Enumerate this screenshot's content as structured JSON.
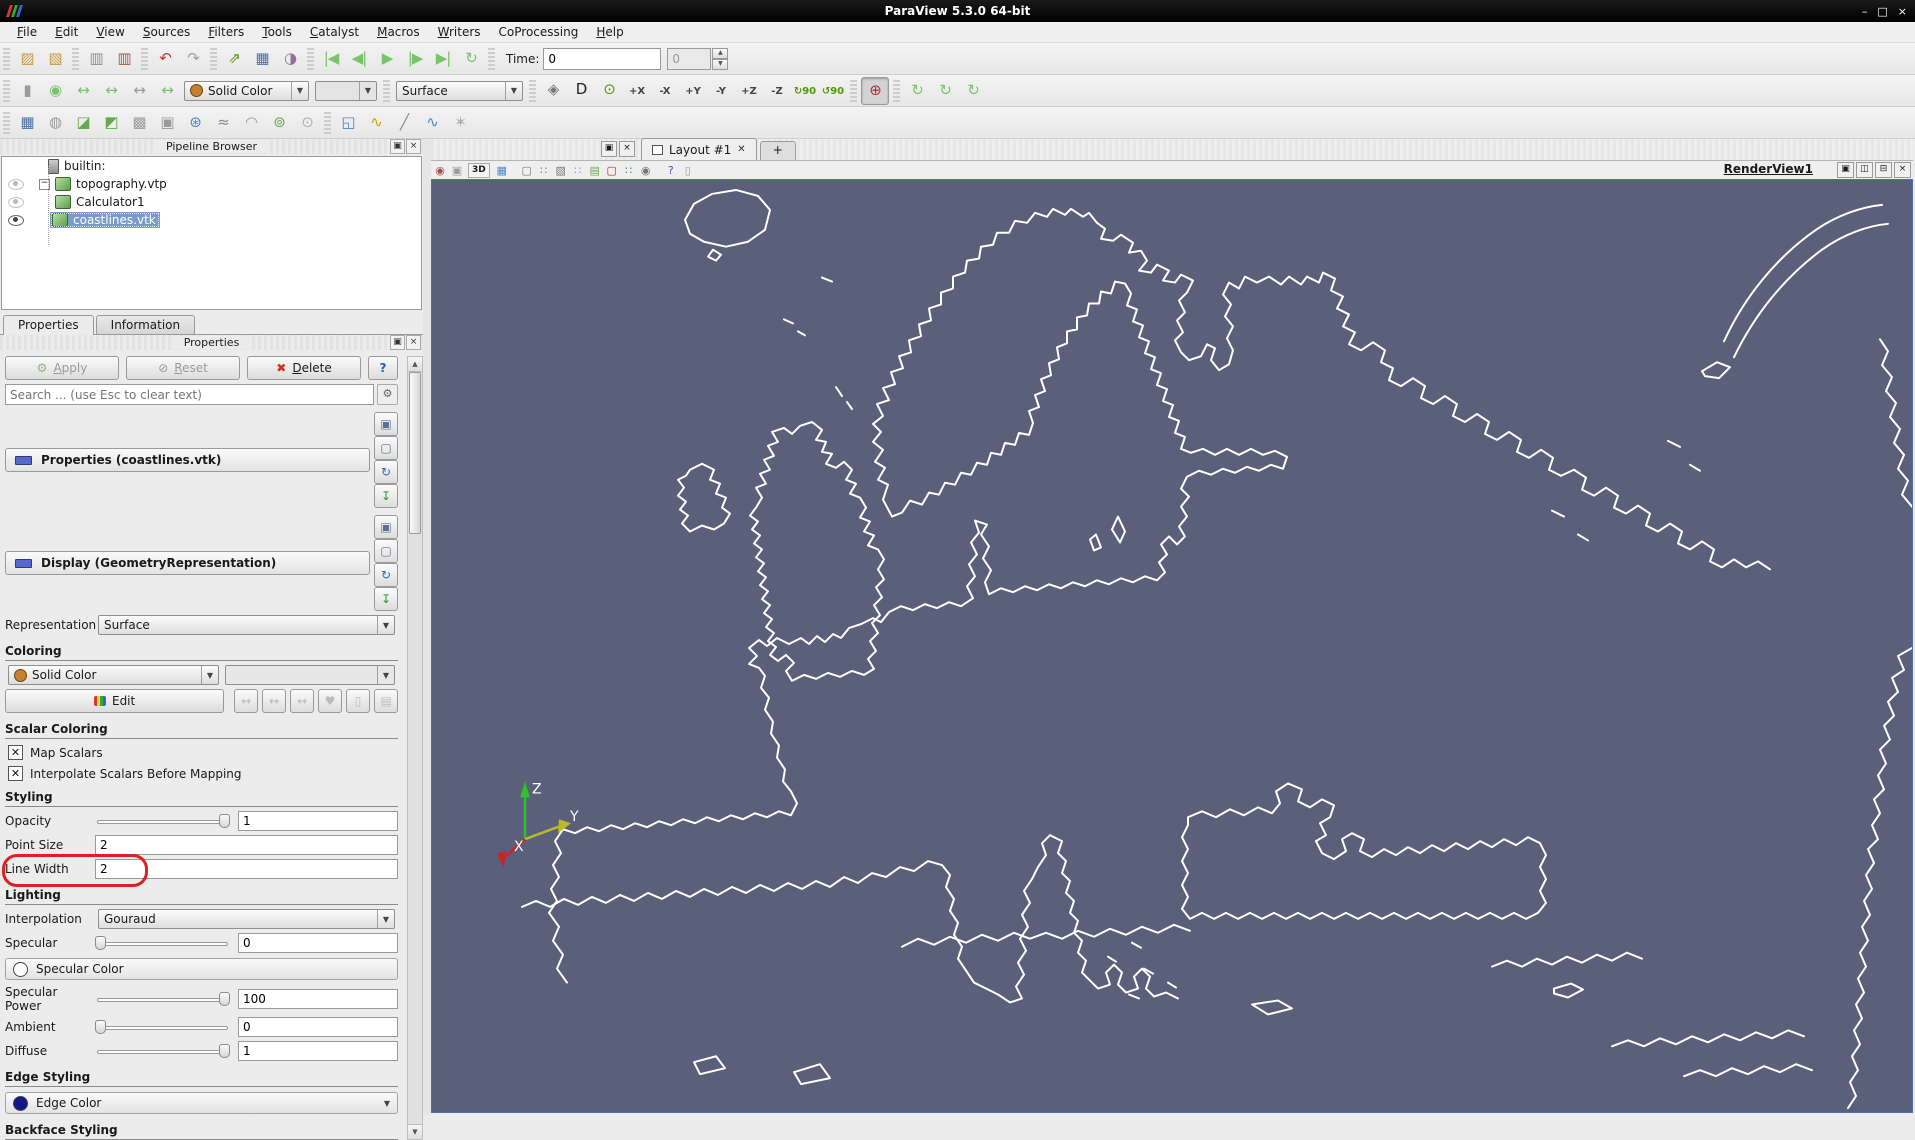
{
  "window": {
    "title": "ParaView 5.3.0 64-bit",
    "minimize": "–",
    "maximize": "□",
    "close": "×"
  },
  "menu": {
    "items": [
      {
        "label": "File",
        "u": 0
      },
      {
        "label": "Edit",
        "u": 0
      },
      {
        "label": "View",
        "u": 0
      },
      {
        "label": "Sources",
        "u": 0
      },
      {
        "label": "Filters",
        "u": 0
      },
      {
        "label": "Tools",
        "u": 0
      },
      {
        "label": "Catalyst",
        "u": 0
      },
      {
        "label": "Macros",
        "u": 0
      },
      {
        "label": "Writers",
        "u": 0
      },
      {
        "label": "CoProcessing",
        "u": -1
      },
      {
        "label": "Help",
        "u": 0
      }
    ]
  },
  "toolbar1": {
    "file_group": [
      {
        "name": "open-icon",
        "glyph": "▨",
        "color": "#c59a3f"
      },
      {
        "name": "save-data-icon",
        "glyph": "▧",
        "color": "#c59a3f"
      }
    ],
    "server_group": [
      {
        "name": "connect-icon",
        "glyph": "▥",
        "color": "#8f8f8f"
      },
      {
        "name": "disconnect-icon",
        "glyph": "▥",
        "color": "#a2564a"
      }
    ],
    "undo_group": [
      {
        "name": "undo-icon",
        "glyph": "↶",
        "color": "#c0392b"
      },
      {
        "name": "redo-icon",
        "glyph": "↷",
        "color": "#a0a0a0"
      }
    ],
    "state_group": [
      {
        "name": "load-state-icon",
        "glyph": "⇗",
        "color": "#4e9a06"
      },
      {
        "name": "save-animation-icon",
        "glyph": "▦",
        "color": "#4a6fa5"
      },
      {
        "name": "color-palette-icon",
        "glyph": "◑",
        "color": "#8f6f9f"
      }
    ],
    "vcr_group": [
      {
        "name": "first-frame-icon",
        "glyph": "|◀",
        "color": "#79c36a"
      },
      {
        "name": "previous-frame-icon",
        "glyph": "◀|",
        "color": "#79c36a"
      },
      {
        "name": "play-icon",
        "glyph": "▶",
        "color": "#79c36a"
      },
      {
        "name": "next-frame-icon",
        "glyph": "|▶",
        "color": "#79c36a"
      },
      {
        "name": "last-frame-icon",
        "glyph": "▶|",
        "color": "#79c36a"
      },
      {
        "name": "loop-icon",
        "glyph": "↻",
        "color": "#79c36a"
      }
    ],
    "time_label": "Time:",
    "time_value": "0",
    "frame_value": "0"
  },
  "toolbar2": {
    "color_group": [
      {
        "name": "toggle-color-legend-icon",
        "glyph": "▮",
        "color": "#9a9a9a"
      },
      {
        "name": "edit-color-map-icon",
        "glyph": "◉",
        "color": "#79c36a"
      },
      {
        "name": "rescale-data-range-icon",
        "glyph": "↔",
        "color": "#79c36a"
      },
      {
        "name": "rescale-custom-range-icon",
        "glyph": "↔",
        "color": "#79c36a"
      },
      {
        "name": "rescale-temporal-range-icon",
        "glyph": "↔",
        "color": "#9a9a9a"
      },
      {
        "name": "rescale-visible-range-icon",
        "glyph": "↔",
        "color": "#79c36a"
      }
    ],
    "color_by_value": "Solid Color",
    "color_by_dot": "#c87f2f",
    "array_value": "",
    "representation_value": "Surface",
    "combo_arrow": "▼",
    "camera_group": [
      {
        "name": "reset-camera-icon",
        "glyph": "◈",
        "color": "#777777"
      },
      {
        "name": "zoom-to-data-icon",
        "glyph": "D",
        "color": "#222222"
      },
      {
        "name": "zoom-to-selection-icon",
        "glyph": "⊙",
        "color": "#4e9a06"
      },
      {
        "name": "view-plus-x-icon",
        "glyph": "+X",
        "color": "#444444",
        "ax": true
      },
      {
        "name": "view-minus-x-icon",
        "glyph": "-X",
        "color": "#444444",
        "ax": true
      },
      {
        "name": "view-plus-y-icon",
        "glyph": "+Y",
        "color": "#444444",
        "ax": true
      },
      {
        "name": "view-minus-y-icon",
        "glyph": "-Y",
        "color": "#444444",
        "ax": true
      },
      {
        "name": "view-plus-z-icon",
        "glyph": "+Z",
        "color": "#444444",
        "ax": true
      },
      {
        "name": "view-minus-z-icon",
        "glyph": "-Z",
        "color": "#444444",
        "ax": true
      },
      {
        "name": "rotate-plus-90-icon",
        "glyph": "↻90",
        "color": "#4e9a06",
        "ax": true
      },
      {
        "name": "rotate-minus-90-icon",
        "glyph": "↺90",
        "color": "#4e9a06",
        "ax": true
      }
    ],
    "axes_toggle": [
      {
        "name": "show-orientation-axes-icon",
        "glyph": "⊕",
        "color": "#b03030",
        "pressed": true
      }
    ],
    "center_group": [
      {
        "name": "show-center-rotation-icon",
        "glyph": "↻",
        "color": "#79c36a"
      },
      {
        "name": "pick-center-icon",
        "glyph": "↻",
        "color": "#79c36a"
      },
      {
        "name": "reset-center-icon",
        "glyph": "↻",
        "color": "#79c36a"
      }
    ]
  },
  "toolbar3": {
    "filters_group": [
      {
        "name": "calculator-icon",
        "glyph": "▦",
        "color": "#4a6fa5"
      },
      {
        "name": "contour-icon",
        "glyph": "◍",
        "color": "#9a9a9a"
      },
      {
        "name": "clip-icon",
        "glyph": "◪",
        "color": "#6aa84f"
      },
      {
        "name": "slice-icon",
        "glyph": "◩",
        "color": "#6aa84f"
      },
      {
        "name": "threshold-icon",
        "glyph": "▩",
        "color": "#9a9a9a"
      },
      {
        "name": "extract-subset-icon",
        "glyph": "▣",
        "color": "#9a9a9a"
      },
      {
        "name": "glyph-icon",
        "glyph": "⊛",
        "color": "#4a86c8"
      },
      {
        "name": "stream-tracer-icon",
        "glyph": "≈",
        "color": "#8a8a8a"
      },
      {
        "name": "warp-icon",
        "glyph": "◠",
        "color": "#9a9a9a"
      },
      {
        "name": "group-datasets-icon",
        "glyph": "⊚",
        "color": "#6aa84f"
      },
      {
        "name": "extract-level-icon",
        "glyph": "⊙",
        "color": "#b0b0b0"
      }
    ],
    "data_group": [
      {
        "name": "extract-block-icon",
        "glyph": "◱",
        "color": "#4a86c8"
      },
      {
        "name": "plot-selection-over-time-icon",
        "glyph": "∿",
        "color": "#c8a200"
      },
      {
        "name": "plot-over-line-icon",
        "glyph": "╱",
        "color": "#8a8a8a"
      },
      {
        "name": "plot-data-over-time-icon",
        "glyph": "∿",
        "color": "#4a86c8"
      },
      {
        "name": "tessellate-icon",
        "glyph": "✶",
        "color": "#b0b0b0"
      }
    ]
  },
  "pipeline": {
    "title": "Pipeline Browser",
    "float_glyph": "▣",
    "close_glyph": "×",
    "expander_glyph": "−",
    "items": [
      "builtin:",
      "topography.vtp",
      "Calculator1",
      "coastlines.vtk"
    ]
  },
  "panel_tabs": {
    "properties": "Properties",
    "information": "Information"
  },
  "properties": {
    "dock_title": "Properties",
    "apply": "Apply",
    "apply_glyph": "⚙",
    "reset": "Reset",
    "reset_glyph": "⊘",
    "delete": "Delete",
    "delete_glyph": "✖",
    "help": "?",
    "search_placeholder": "Search ... (use Esc to clear text)",
    "gear_glyph": "⚙",
    "section1": "Properties (coastlines.vtk)",
    "section2": "Display (GeometryRepresentation)",
    "section_buttons": [
      {
        "name": "copy-properties-icon",
        "glyph": "▣",
        "color": "#5a6f8f"
      },
      {
        "name": "paste-properties-icon",
        "glyph": "▢",
        "color": "#5a6f8f"
      },
      {
        "name": "reset-defaults-icon",
        "glyph": "↻",
        "color": "#2a6db0"
      },
      {
        "name": "save-defaults-icon",
        "glyph": "↧",
        "color": "#3a8f3a"
      }
    ],
    "representation_label": "Representation",
    "representation_value": "Surface",
    "coloring_heading": "Coloring",
    "color_by_value": "Solid Color",
    "edit_label": "Edit",
    "edit_row_buttons": [
      {
        "name": "rescale-data-icon",
        "glyph": "↔",
        "color": "#bbbbbb"
      },
      {
        "name": "rescale-custom-icon",
        "glyph": "↔",
        "color": "#bbbbbb"
      },
      {
        "name": "rescale-temporal-icon",
        "glyph": "↔",
        "color": "#bbbbbb"
      },
      {
        "name": "choose-preset-icon",
        "glyph": "♥",
        "color": "#bbbbbb"
      },
      {
        "name": "show-legend-icon",
        "glyph": "▯",
        "color": "#bbbbbb"
      },
      {
        "name": "edit-legend-icon",
        "glyph": "▤",
        "color": "#bbbbbb"
      }
    ],
    "scalar_heading": "Scalar Coloring",
    "check_glyph": "✕",
    "map_scalars": "Map Scalars",
    "interpolate": "Interpolate Scalars Before Mapping",
    "styling_heading": "Styling",
    "opacity_label": "Opacity",
    "opacity_value": "1",
    "point_size_label": "Point Size",
    "point_size_value": "2",
    "line_width_label": "Line Width",
    "line_width_value": "2",
    "lighting_heading": "Lighting",
    "interpolation_label": "Interpolation",
    "interpolation_value": "Gouraud",
    "specular_label": "Specular",
    "specular_value": "0",
    "specular_color_label": "Specular Color",
    "specular_power_label": "Specular Power",
    "specular_power_value": "100",
    "ambient_label": "Ambient",
    "ambient_value": "0",
    "diffuse_label": "Diffuse",
    "diffuse_value": "1",
    "edge_heading": "Edge Styling",
    "edge_color_label": "Edge Color",
    "edge_color": "#15158c",
    "backface_heading": "Backface Styling",
    "annotation_color": "#e01f1f"
  },
  "layout": {
    "float_glyph": "▣",
    "close_glyph": "×",
    "tab_label": "Layout #1",
    "tab_close": "✕",
    "new_tab": "+",
    "view_title": "RenderView1",
    "mode_3d": "3D",
    "vt_left": [
      {
        "name": "adjust-camera-icon",
        "glyph": "◉",
        "color": "#a05050"
      },
      {
        "name": "capture-screenshot-icon",
        "glyph": "▣",
        "color": "#9a9a9a"
      }
    ],
    "vt_grid": [
      {
        "name": "axes-grid-icon",
        "glyph": "▦",
        "color": "#4a86c8"
      }
    ],
    "vt_select": [
      {
        "name": "select-cells-on-icon",
        "glyph": "▢",
        "color": "#777777"
      },
      {
        "name": "select-points-on-icon",
        "glyph": "∷",
        "color": "#777777"
      },
      {
        "name": "select-cells-through-icon",
        "glyph": "▧",
        "color": "#777777"
      },
      {
        "name": "select-points-through-icon",
        "glyph": "∷",
        "color": "#999999"
      },
      {
        "name": "select-block-icon",
        "glyph": "▤",
        "color": "#6aa84f"
      },
      {
        "name": "interactive-select-cells-icon",
        "glyph": "▢",
        "color": "#b03030"
      },
      {
        "name": "interactive-select-points-icon",
        "glyph": "∷",
        "color": "#3a8f3a"
      },
      {
        "name": "hover-cells-icon",
        "glyph": "◉",
        "color": "#777777"
      }
    ],
    "vt_end": [
      {
        "name": "help-icon",
        "glyph": "?",
        "color": "#2a5db0"
      },
      {
        "name": "center-axes-icon",
        "glyph": "▯",
        "color": "#9a9a9a"
      }
    ],
    "view_buttons": [
      {
        "name": "maximize-view-button",
        "glyph": "▣"
      },
      {
        "name": "split-horizontal-button",
        "glyph": "◫"
      },
      {
        "name": "split-vertical-button",
        "glyph": "⊟"
      },
      {
        "name": "close-view-button",
        "glyph": "×"
      }
    ]
  },
  "render_view": {
    "background": "#5a5f7a",
    "stroke": "#ffffff",
    "border": "#4e6fb0",
    "coastlines": [
      "M253,40 L262,24 280,14 304,10 326,16 338,30 333,50 316,62 294,67 272,62 258,54 Z",
      "M281,70 l8,5 -5,6 -8,-4 Z",
      "M460,338 L451,321 456,306 446,301 453,289 443,283 451,271 441,263 449,253 441,245 451,237 445,225 457,221 451,209 463,205 459,193 471,189 467,177 479,173 477,161 489,157 487,145 499,141 497,129 509,125 509,113 521,109 521,97 533,93 535,81 547,79 549,67 561,65 565,53 577,53 583,41 595,43 603,33 615,37 621,29 633,35 639,29 651,37 657,33 665,43 673,49 669,59 681,61 689,55 701,63 697,73 709,71 715,81 707,91 719,93 725,85 737,91 731,101 743,103 749,95 761,101 755,113 747,121 753,133 745,141 751,153 743,161 749,173 757,181 769,177 775,165 783,169 779,181 787,191 797,185 801,171 795,159 801,147 793,137 799,125 791,115 797,103 807,109 813,97 825,103 837,97 849,105 857,97 869,105 875,97 887,103 891,93 903,99 899,111 911,117 905,129 917,135 911,147 923,153 917,165 929,171 941,163 953,171 949,183 961,189 957,201 969,207 981,199 993,207 989,219 1001,225 1013,217 1025,225 1021,237 1033,243 1045,235 1057,243 1053,255 1065,261 1077,253 1089,261 1085,273 1097,279 1109,271 1121,279 1117,291 1129,297",
      "M460,338 L470,334 478,322 490,326 497,314 507,316 513,304 523,306 529,294 539,296 545,284 555,286 559,274 569,276 573,264 583,266 587,254 597,256 601,244 597,232 607,228 603,216 613,212 609,200 619,196 617,184 627,180 625,168 635,164 635,152 645,150 645,138 655,136 657,124 667,124 669,112 679,114 683,102 693,104 699,114 695,126 705,130 701,142 711,146 707,158 717,162 713,174 723,178 719,190 729,194 725,206 735,210 731,222 741,226 737,238 747,242 743,254 753,258 749,270 759,274 771,270 783,276 795,270 807,276 819,270 831,276 843,272 855,278 851,290 839,286 827,292 815,288 803,294 791,290 779,296 767,292 755,298 749,310 757,318 749,328 755,338 747,348 753,358 745,366 737,358 729,366 735,376 727,384 733,394 725,402 713,398 701,404 689,400 677,406 665,402 653,408 641,404 629,410 617,406 605,412 593,408 581,414 569,410 557,416 553,404 559,392 551,380 557,368 549,356 555,346 543,342 547,354 539,364 545,376 537,386 543,398 535,408 541,420 529,428 517,424 505,430 493,426 481,432 469,428 457,434 449,444 441,440 429,446 417,450 409,460 401,456 393,464 385,458 377,466 369,460 357,466 345,460 335,468 327,462 317,470 325,478 317,486 327,490 333,498 329,510 337,520 333,532 341,544 339,556 347,568 345,580 353,592 351,604 359,614 365,626 359,638 347,634 335,640 323,636 311,642 299,638 287,644 275,640 263,646 251,642 239,648 227,644 215,650 203,646 191,652 179,648 167,654 155,650 143,656 131,652 123,664 129,676 121,688 127,700 119,712 125,724 117,736",
      "M368,247 L380,243 390,251 384,261 394,263 390,273 400,275 394,285 404,289 412,283 420,291 414,301 424,305 418,315 428,319 434,329 428,339 438,343 432,353 442,357 436,367 446,371 452,381 446,391 452,401 444,409 450,419 442,427 448,437 440,445 446,455 438,463 444,473 436,481 442,491 432,497 420,493 408,499 396,495 384,501 372,497 360,503 354,493 362,485 354,477 346,483 338,477 344,469 336,463 342,455 334,449 340,441 332,435 338,427 330,421 336,413 328,407 334,399 326,393 332,385 324,379 330,371 322,365 328,357 320,351 326,343 318,337 324,329 330,319 324,309 334,305 328,295 338,291 332,281 342,277 336,267 346,263 340,253 352,249 360,255 Z",
      "M258,291 L270,285 282,291 278,301 288,305 284,315 294,319 290,329 298,335 292,345 282,351 270,347 258,353 250,345 256,337 248,331 254,323 246,317 252,309 246,301 254,297 Z",
      "M686,338 l7,15 -5,11 -8,-13 Z",
      "M664,356 l5,13 -7,3 -4,-11 Z",
      "M1292,162 C1312,118 1344,78 1384,50 1406,35 1430,27 1450,25",
      "M1302,178 C1322,136 1352,98 1390,70 1412,54 1436,46 1456,44",
      "M1270,192 l15,-9 13,5 -11,11 -14,-2 Z",
      "M1448,160 L1456,172 1450,186 1460,198 1454,212 1464,224 1458,238 1468,250 1462,264 1472,276 1466,290 1476,302 1470,316 1480,328",
      "M1129,297 L1142,291 1154,299 1150,311 1162,317 1174,309 1186,317 1182,329 1194,335 1206,327 1218,335 1214,347 1226,353 1238,345 1250,353 1246,365 1258,371 1270,363 1282,371 1278,383 1290,389 1302,381 1314,389 1326,383 1338,391",
      "M90,730 L104,724 118,730 132,722 146,728 160,720 174,726 188,718 202,724 216,716 230,722 244,714 258,720 272,712 286,718 300,710 314,716 328,708 342,714 356,706 370,712 384,704 398,710 412,700 426,706 440,696 454,700 468,690 482,694 496,684 510,688 518,698 514,710 522,722 518,734 526,746 522,758 530,770 526,782 534,794 542,806 554,812 566,818 578,826 590,822 584,810 592,798 586,786 594,774 588,762 596,750 590,738 598,726 592,714 600,702 606,690 614,678 610,666 618,658 630,664 626,676 634,684 630,696 638,704 634,716 642,724 638,736 646,744 642,756 650,764 646,776 654,784 650,796 658,804 666,812 678,808 674,796 682,788 690,796 686,808 694,816 706,812 702,800 710,792 718,800 714,812 722,820 734,816 746,822",
      "M756,640 L770,634 784,640 798,632 812,638 826,630 840,636 848,626 844,614 856,606 870,612 866,624 878,630 890,622 902,628 898,640 888,646 894,658 884,664 890,676 902,682 914,674 910,662 920,656 932,662 928,674 940,680 952,672 964,678 976,670 988,676 1000,668 1012,674 1024,666 1036,672 1048,664 1060,670 1072,662 1084,668 1096,660 1108,666 1114,678 1108,690 1114,702 1108,714 1114,726 1106,736 1094,742 1082,736 1070,742 1058,736 1046,742 1034,736 1022,742 1010,736 998,742 986,736 974,742 962,736 950,742 938,736 926,742 914,736 902,742 890,736 878,742 866,736 854,742 842,736 830,742 818,736 806,742 794,736 782,742 770,736 758,742 750,732 756,720 750,708 756,696 750,684 756,672 750,660 756,648 Z",
      "M470,770 L486,762 502,768 518,760 534,766 550,758 566,764 582,756 598,762 614,756 630,762 646,754 662,760 678,752 694,758 710,750 726,756 742,748 758,754",
      "M1060,790 L1075,784 1090,790 1105,782 1120,788 1135,780 1150,786 1165,778 1180,784 1195,776 1210,782",
      "M1122,812 l17,-5 12,6 -15,8 -14,-4 Z",
      "M1180,870 L1196,864 1212,870 1228,862 1244,868 1260,860 1276,866 1292,858 1308,864 1324,856 1340,862 1356,854 1372,860",
      "M1252,900 L1268,894 1284,900 1300,892 1316,898 1332,890 1348,896 1364,888 1380,894",
      "M1480,470 L1466,478 1472,492 1460,500 1466,514 1456,524 1462,538 1452,548 1458,562 1448,572 1454,586 1446,598 1452,612 1442,622 1448,636 1440,648 1446,662 1436,672 1442,686 1434,698 1440,712 1432,724 1438,738 1430,750 1436,764 1428,776 1434,790 1426,802 1432,816 1424,828 1430,842 1422,854 1428,868 1420,880 1426,894 1418,906 1424,920 1416,932",
      "M117,736 L127,750 121,764 131,778 125,792 135,806",
      "M262,886 l22,-6 9,12 -25,6 Z",
      "M362,896 l26,-8 10,14 -29,6 Z",
      "M820,828 l26,-4 14,8 -24,6 Z",
      "M352,140 l9,4 M366,152 l7,4 M390,98 l10,4 M404,208 l6,9 M415,223 l5,7 M1236,262 l12,6 M1258,286 l10,6 M700,766 l9,5 M676,780 l8,5 M712,792 l9,5 M736,806 l8,5 M697,818 l10,4 M1120,332 l12,6 M1146,356 l10,6"
    ],
    "axes": {
      "x_label": "X",
      "y_label": "Y",
      "z_label": "Z",
      "x_color": "#cc2222",
      "y_color": "#b9b92a",
      "z_color": "#2fbf2f"
    }
  }
}
